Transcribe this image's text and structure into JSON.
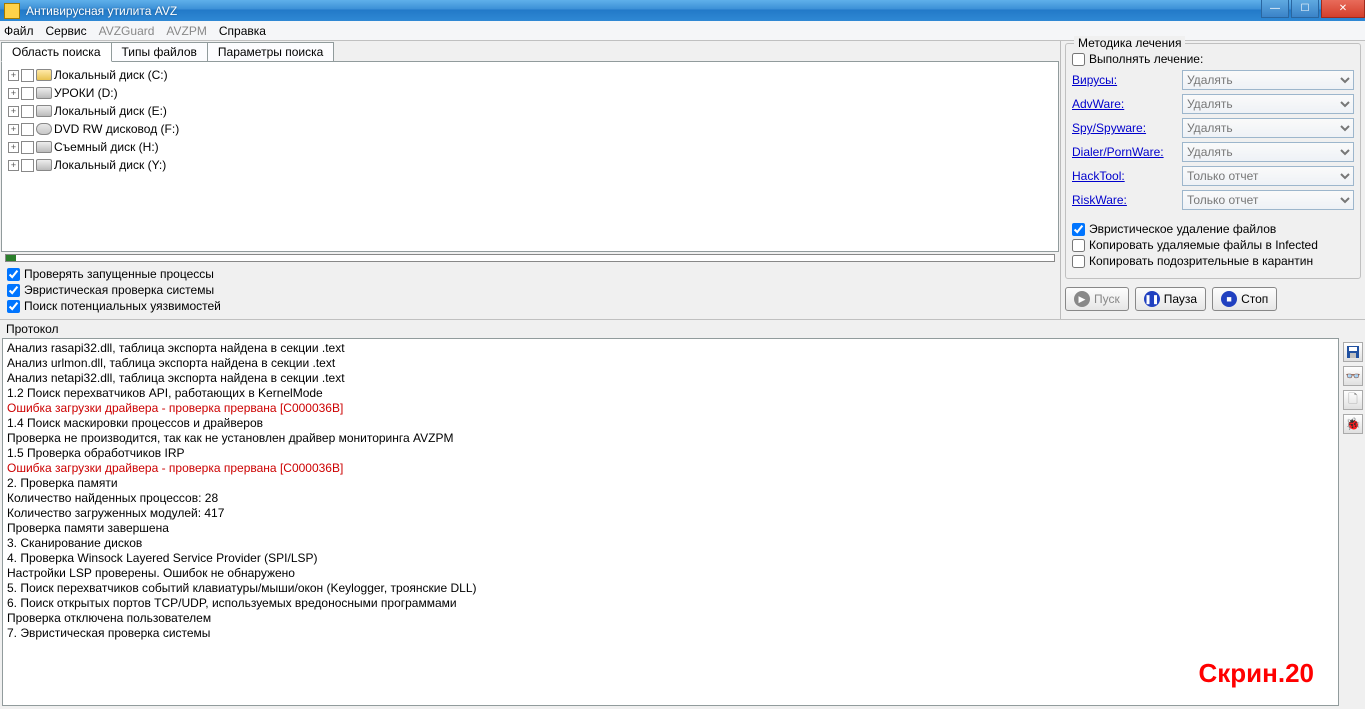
{
  "window": {
    "title": "Антивирусная утилита AVZ"
  },
  "menu": {
    "file": "Файл",
    "service": "Сервис",
    "avzguard": "AVZGuard",
    "avzpm": "AVZPM",
    "help": "Справка"
  },
  "tabs": {
    "search_area": "Область поиска",
    "file_types": "Типы файлов",
    "search_params": "Параметры поиска"
  },
  "drives": [
    {
      "label": "Локальный диск (C:)",
      "icon": "yellow"
    },
    {
      "label": "УРОКИ (D:)",
      "icon": "hdd"
    },
    {
      "label": "Локальный диск (E:)",
      "icon": "hdd"
    },
    {
      "label": "DVD RW дисковод (F:)",
      "icon": "dvd"
    },
    {
      "label": "Съемный диск (H:)",
      "icon": "hdd"
    },
    {
      "label": "Локальный диск (Y:)",
      "icon": "hdd"
    }
  ],
  "options": {
    "check_processes": "Проверять запущенные процессы",
    "heuristic": "Эвристическая проверка системы",
    "vuln": "Поиск потенциальных уязвимостей"
  },
  "treatment": {
    "title": "Методика лечения",
    "perform": "Выполнять лечение:",
    "rows": [
      {
        "label": "Вирусы:",
        "value": "Удалять"
      },
      {
        "label": "AdvWare:",
        "value": "Удалять"
      },
      {
        "label": "Spy/Spyware:",
        "value": "Удалять"
      },
      {
        "label": "Dialer/PornWare:",
        "value": "Удалять"
      },
      {
        "label": "HackTool:",
        "value": "Только отчет"
      },
      {
        "label": "RiskWare:",
        "value": "Только отчет"
      }
    ],
    "heur_delete": "Эвристическое удаление файлов",
    "copy_infected": "Копировать удаляемые файлы в  Infected",
    "copy_quarantine": "Копировать подозрительные в  карантин"
  },
  "buttons": {
    "start": "Пуск",
    "pause": "Пауза",
    "stop": "Стоп"
  },
  "protocol_label": "Протокол",
  "log": [
    {
      "text": "Анализ rasapi32.dll, таблица экспорта найдена в секции .text"
    },
    {
      "text": "Анализ urlmon.dll, таблица экспорта найдена в секции .text"
    },
    {
      "text": "Анализ netapi32.dll, таблица экспорта найдена в секции .text"
    },
    {
      "text": "1.2 Поиск перехватчиков API, работающих в KernelMode"
    },
    {
      "text": "Ошибка загрузки драйвера - проверка прервана [C000036B]",
      "err": true
    },
    {
      "text": "1.4 Поиск маскировки процессов и драйверов"
    },
    {
      "text": " Проверка не производится, так как не установлен драйвер мониторинга AVZPM"
    },
    {
      "text": "1.5 Проверка обработчиков IRP"
    },
    {
      "text": "Ошибка загрузки драйвера - проверка прервана [C000036B]",
      "err": true
    },
    {
      "text": "2. Проверка памяти"
    },
    {
      "text": "Количество найденных процессов: 28"
    },
    {
      "text": "Количество загруженных модулей: 417"
    },
    {
      "text": "Проверка памяти завершена"
    },
    {
      "text": "3. Сканирование дисков"
    },
    {
      "text": "4. Проверка Winsock Layered Service Provider (SPI/LSP)"
    },
    {
      "text": " Настройки LSP проверены. Ошибок не обнаружено"
    },
    {
      "text": "5. Поиск перехватчиков событий клавиатуры/мыши/окон (Keylogger, троянские DLL)"
    },
    {
      "text": "6. Поиск открытых портов TCP/UDP, используемых вредоносными программами"
    },
    {
      "text": " Проверка отключена пользователем"
    },
    {
      "text": "7. Эвристическая проверка системы"
    }
  ],
  "watermark": "Скрин.20"
}
